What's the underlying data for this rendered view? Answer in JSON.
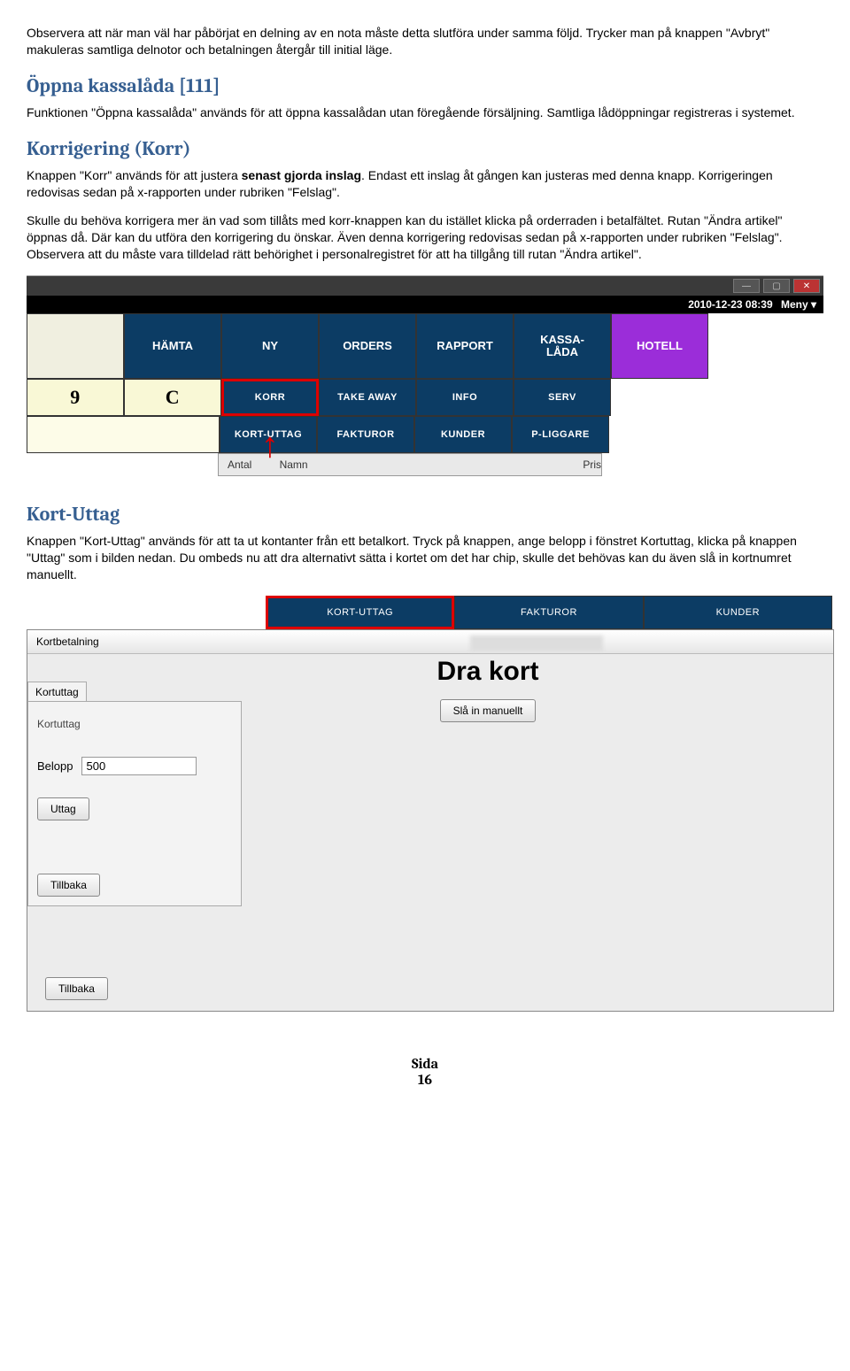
{
  "intro_para": "Observera att när man väl har påbörjat en delning av en nota måste detta slutföra under samma följd. Trycker man på knappen \"Avbryt\" makuleras samtliga delnotor och betalningen återgår till initial läge.",
  "section1": {
    "heading": "Öppna kassalåda [111]",
    "para": "Funktionen \"Öppna kassalåda\" används för att öppna kassalådan utan föregående försäljning. Samtliga lådöppningar registreras i systemet."
  },
  "section2": {
    "heading": "Korrigering (Korr)",
    "para1_a": "Knappen \"Korr\" används för att justera ",
    "para1_b": "senast gjorda inslag",
    "para1_c": ". Endast ett inslag åt gången kan justeras med denna knapp. Korrigeringen redovisas sedan på x-rapporten under rubriken \"Felslag\".",
    "para2": "Skulle du behöva korrigera mer än vad som tillåts med korr-knappen kan du istället klicka på orderraden i betalfältet. Rutan \"Ändra artikel\" öppnas då. Där kan du utföra den korrigering du önskar. Även denna korrigering redovisas sedan på x-rapporten under rubriken \"Felslag\". Observera att du måste vara tilldelad rätt behörighet i personalregistret för att ha tillgång till rutan \"Ändra artikel\"."
  },
  "shot1": {
    "timestamp": "2010-12-23 08:39",
    "menu": "Meny ▾",
    "row1": [
      "HÄMTA",
      "NY",
      "ORDERS",
      "RAPPORT",
      "KASSA-\nLÅDA",
      "HOTELL"
    ],
    "row2_left": [
      "9",
      "C"
    ],
    "row2_right": [
      "KORR",
      "TAKE AWAY",
      "INFO",
      "SERV"
    ],
    "row3": [
      "KORT-UTTAG",
      "FAKTUROR",
      "KUNDER",
      "P-LIGGARE"
    ],
    "list_headers": {
      "a": "Antal",
      "b": "Namn",
      "c": "Pris"
    }
  },
  "section3": {
    "heading": "Kort-Uttag",
    "para": "Knappen \"Kort-Uttag\" används för att ta ut kontanter från ett betalkort. Tryck på knappen, ange belopp i fönstret Kortuttag, klicka på knappen \"Uttag\" som i bilden nedan. Du ombeds nu att dra alternativt sätta i kortet om det har chip, skulle det behövas kan du även slå in kortnumret manuellt."
  },
  "shot2": {
    "toolbar": [
      "KORT-UTTAG",
      "FAKTUROR",
      "KUNDER"
    ],
    "dialog_title": "Kortbetalning",
    "panel_title": "Kortuttag",
    "panel_inner": "Kortuttag",
    "belopp_label": "Belopp",
    "belopp_value": "500",
    "uttag_btn": "Uttag",
    "tillbaka_btn": "Tillbaka",
    "big_label": "Dra kort",
    "manual_btn": "Slå in manuellt"
  },
  "footer": {
    "a": "Sida",
    "b": "16"
  }
}
